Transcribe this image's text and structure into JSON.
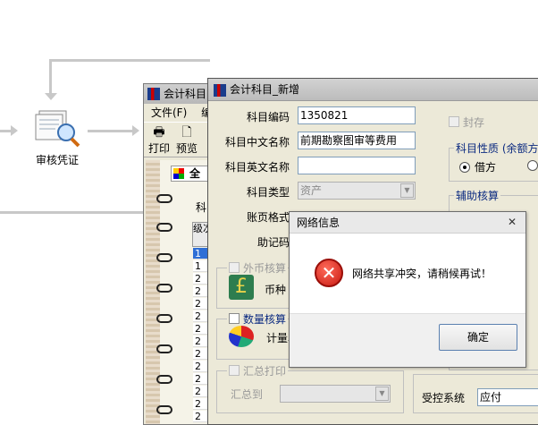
{
  "flow": {
    "node_label": "审核凭证"
  },
  "back_window": {
    "title": "会计科目",
    "menu": [
      "文件(F)",
      "编"
    ],
    "toolbar": [
      "打印",
      "预览"
    ],
    "tab_label": "全",
    "subject_label": "科",
    "level_header": "级次",
    "levels": [
      "1",
      "1",
      "2",
      "2",
      "2",
      "2",
      "2",
      "2",
      "2",
      "2",
      "2",
      "2",
      "2",
      "2"
    ]
  },
  "dialog": {
    "title": "会计科目_新增",
    "fields": {
      "code_label": "科目编码",
      "code_value": "1350821",
      "cn_name_label": "科目中文名称",
      "cn_name_value": "前期勘察图审等费用",
      "en_name_label": "科目英文名称",
      "en_name_value": "",
      "type_label": "科目类型",
      "type_value": "资产",
      "page_format_label": "账页格式",
      "mnemonic_label": "助记码"
    },
    "seal_label": "封存",
    "nature_group": "科目性质 (余额方向)",
    "debit_label": "借方",
    "aux_group": "辅助核算",
    "foreign_group": "外币核算",
    "currency_label": "币种",
    "qty_group": "数量核算",
    "unit_label": "计量单",
    "summary_group": "汇总打印",
    "summary_to_label": "汇总到",
    "control_label": "受控系统",
    "control_value": "应付"
  },
  "message_box": {
    "title": "网络信息",
    "text": "网络共享冲突，请稍候再试！",
    "ok_label": "确定"
  }
}
